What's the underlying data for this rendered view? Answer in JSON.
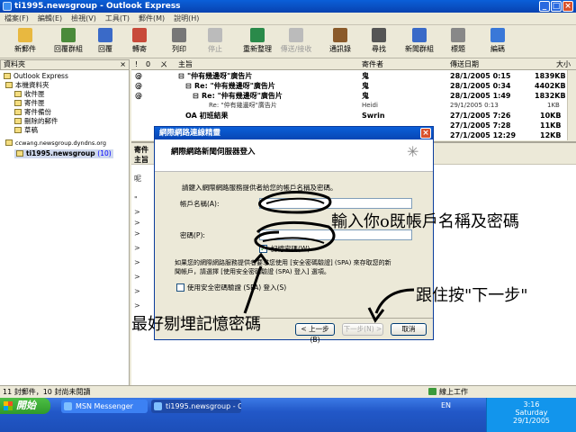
{
  "window": {
    "title": "ti1995.newsgroup - Outlook Express"
  },
  "menu": [
    "檔案(F)",
    "編輯(E)",
    "檢視(V)",
    "工具(T)",
    "郵件(M)",
    "說明(H)"
  ],
  "toolbar": [
    {
      "label": "新郵件",
      "color": "#e8b840",
      "enabled": true
    },
    {
      "label": "回覆群組",
      "color": "#4a8a3a",
      "enabled": true
    },
    {
      "label": "回覆",
      "color": "#3a6ac8",
      "enabled": true
    },
    {
      "label": "轉寄",
      "color": "#c84a3a",
      "enabled": true
    },
    {
      "label": "列印",
      "color": "#777777",
      "enabled": true
    },
    {
      "label": "停止",
      "color": "#bbbbbb",
      "enabled": false
    },
    {
      "label": "重新整理",
      "color": "#2a8a4a",
      "enabled": true
    },
    {
      "label": "傳送/接收",
      "color": "#bbbbbb",
      "enabled": false
    },
    {
      "label": "通訊錄",
      "color": "#8a5a2a",
      "enabled": true
    },
    {
      "label": "尋找",
      "color": "#555555",
      "enabled": true
    },
    {
      "label": "新聞群組",
      "color": "#3a6ac8",
      "enabled": true
    },
    {
      "label": "標題",
      "color": "#888888",
      "enabled": true
    },
    {
      "label": "編碼",
      "color": "#3a78d8",
      "enabled": true
    }
  ],
  "folders": {
    "header": "資料夾",
    "items": [
      "Outlook Express",
      "本機資料夾",
      "收件匣",
      "寄件匣",
      "寄件備份",
      "刪除的郵件",
      "草稿",
      "ccwang.newsgroup.dyndns.org",
      "ti1995.newsgroup"
    ],
    "unread": "(10)"
  },
  "list": {
    "columns": [
      "!",
      "0",
      "ㄨ",
      "主旨",
      "寄件者",
      "傳送日期",
      "大小"
    ],
    "rows": [
      {
        "subject": "\"仲有幾邊呀\"廣告片",
        "from": "鬼",
        "date": "28/1/2005 0:15",
        "size": "1839KB",
        "bold": true
      },
      {
        "subject": "Re: \"仲有幾邊呀\"廣告片",
        "from": "鬼",
        "date": "28/1/2005 0:34",
        "size": "4402KB",
        "bold": true
      },
      {
        "subject": "Re: \"仲有幾邊呀\"廣告片",
        "from": "鬼",
        "date": "28/1/2005 1:49",
        "size": "1832KB",
        "bold": true
      },
      {
        "subject": "Re: \"仲有幾邊呀\"廣告片",
        "from": "Heidi",
        "date": "29/1/2005 0:13",
        "size": "1KB",
        "bold": false
      },
      {
        "subject": "OA 初班結果",
        "from": "Swrin",
        "date": "27/1/2005 7:26",
        "size": "10KB",
        "bold": true
      },
      {
        "subject": "",
        "from": "",
        "date": "27/1/2005 7:28",
        "size": "11KB",
        "bold": true
      },
      {
        "subject": "",
        "from": "",
        "date": "27/1/2005 12:29",
        "size": "12KB",
        "bold": true
      }
    ]
  },
  "preview": {
    "header_from": "寄件",
    "header_subject": "主旨",
    "lines": [
      "呢",
      "\"",
      ">",
      ">",
      ">",
      ">",
      ">",
      ">",
      ">",
      ">"
    ]
  },
  "dialog": {
    "title": "網際網路連線精靈",
    "heading": "網際網路新聞伺服器登入",
    "intro": "請鍵入網際網路服務提供者給您的帳戶名稱及密碼。",
    "account_label": "帳戶名稱(A):",
    "password_label": "密碼(P):",
    "remember": "記憶密碼(W)",
    "spa_note_line1": "如果您的網際網路服務提供者要求您使用 [安全密碼驗證] (SPA) 來存取您的新",
    "spa_note_line2": "聞帳戶，請選擇 [使用安全密碼驗證 (SPA) 登入] 選項。",
    "spa_checkbox": "使用安全密碼驗證 (SPA) 登入(S)",
    "back_button": "< 上一步(B)",
    "next_button": "下一步(N) >",
    "cancel_button": "取消"
  },
  "annotations": {
    "enter_credentials": "輸入你o既帳戶名稱及密碼",
    "press_next": "跟住按\"下一步\"",
    "uncheck_remember": "最好剔埋記憶密碼"
  },
  "status": {
    "left": "11 封郵件，10 封尚未閱讀",
    "online": "線上工作"
  },
  "taskbar": {
    "start": "開始",
    "tasks": [
      "MSN Messenger",
      "ti1995.newsgroup - O..."
    ],
    "lang": "EN",
    "time": "3:16",
    "day": "Saturday",
    "date": "29/1/2005"
  }
}
